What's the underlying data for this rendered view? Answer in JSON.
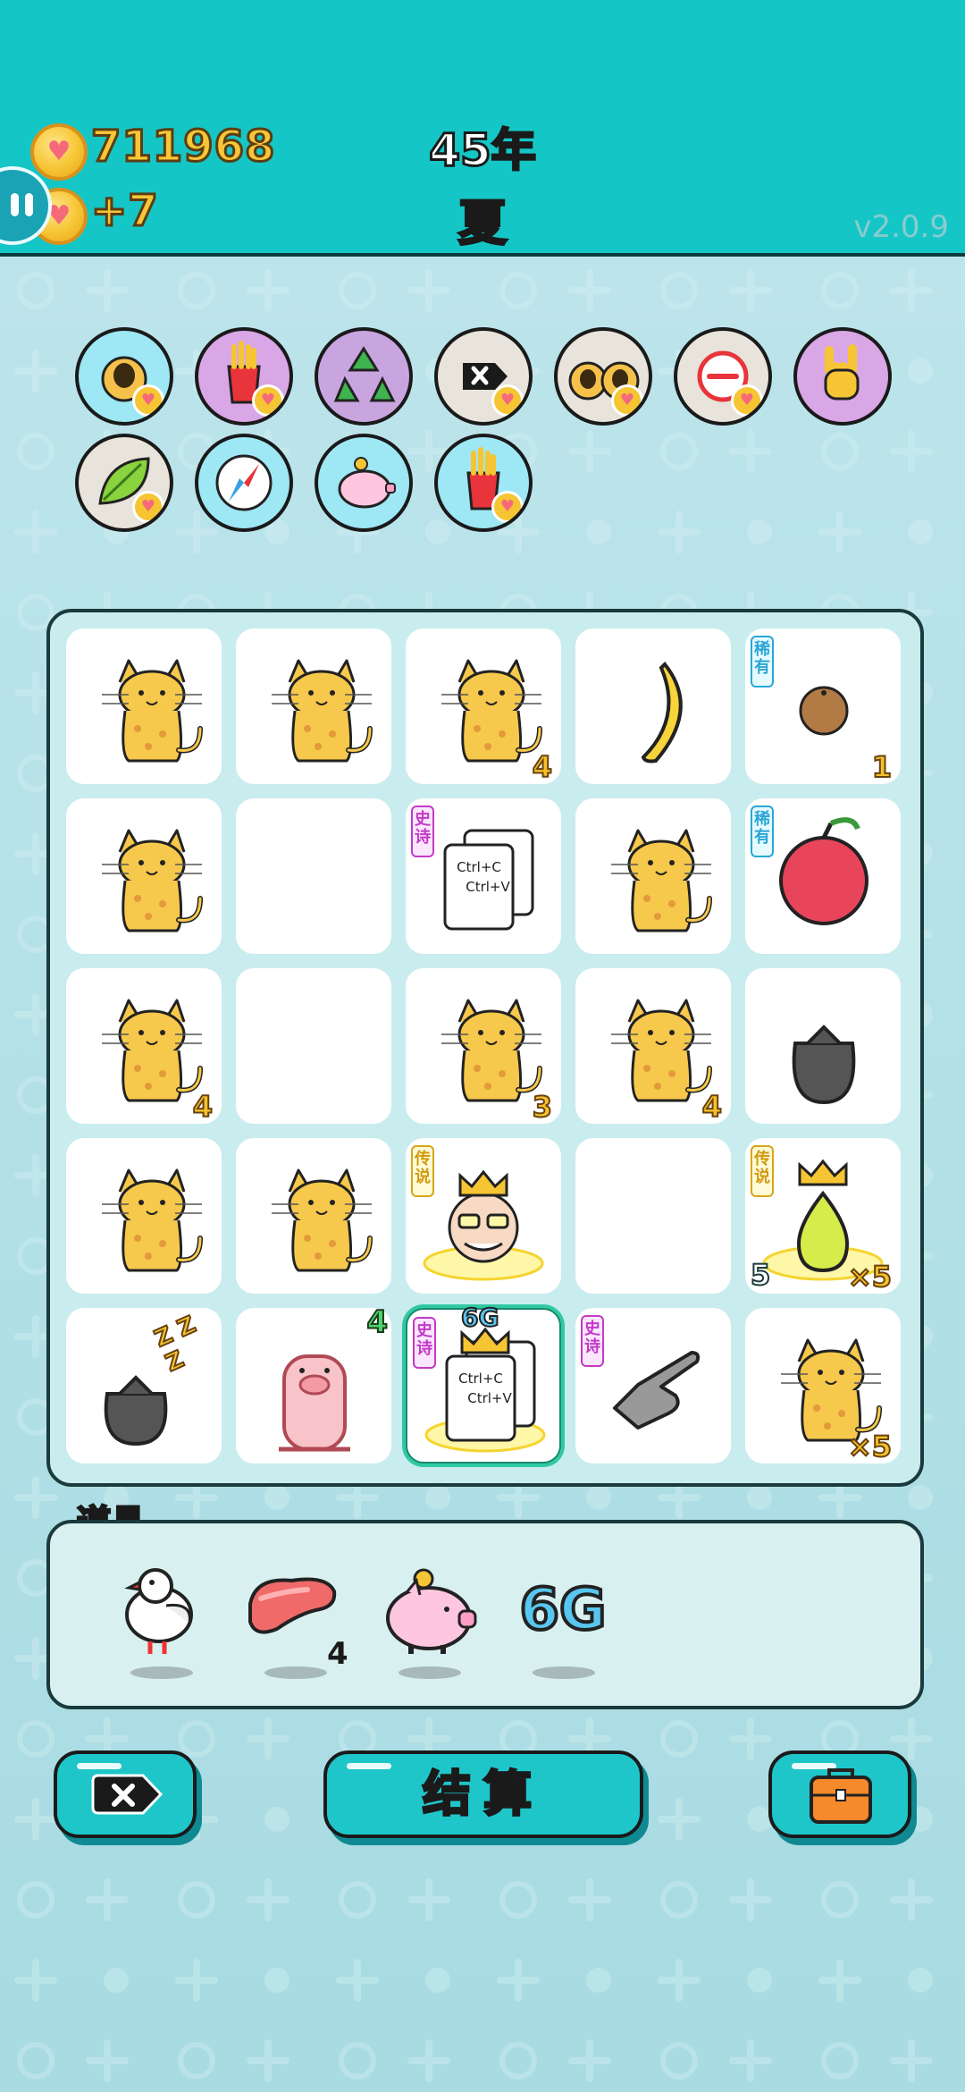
{
  "header": {
    "coins": "711968",
    "income": "+7",
    "year": "45年",
    "season": "夏",
    "version": "v2.0.9"
  },
  "buffs": [
    {
      "icon": "cat-portrait-icon",
      "bg": "#9ee7f4",
      "heart": true
    },
    {
      "icon": "fries-icon",
      "bg": "#d9a6e6",
      "heart": true
    },
    {
      "icon": "recycle-icon",
      "bg": "#c9a5e0",
      "heart": false
    },
    {
      "icon": "delete-tag-icon",
      "bg": "#e8e4dc",
      "heart": true
    },
    {
      "icon": "cat-pair-icon",
      "bg": "#e8e4dc",
      "heart": true
    },
    {
      "icon": "minus-circle-icon",
      "bg": "#e8e4dc",
      "heart": true
    },
    {
      "icon": "rock-hand-icon",
      "bg": "#d9a6e6",
      "heart": false
    },
    {
      "icon": "leaf-icon",
      "bg": "#e8e4dc",
      "heart": true
    },
    {
      "icon": "compass-icon",
      "bg": "#9ee7f4",
      "heart": false
    },
    {
      "icon": "piggy-bank-icon",
      "bg": "#9ee7f4",
      "heart": false
    },
    {
      "icon": "fries-icon",
      "bg": "#9ee7f4",
      "heart": true
    }
  ],
  "board": [
    [
      {
        "item": "cat"
      },
      {
        "item": "cat"
      },
      {
        "item": "cat",
        "qty": "4"
      },
      {
        "item": "banana"
      },
      {
        "item": "coconut",
        "rarity": "稀有",
        "rarity_type": "rare",
        "qty": "1"
      }
    ],
    [
      {
        "item": "cat"
      },
      {
        "item": "empty"
      },
      {
        "item": "ctrlcv",
        "rarity": "史诗",
        "rarity_type": "epic",
        "text1": "Ctrl+C",
        "text2": "Ctrl+V"
      },
      {
        "item": "cat"
      },
      {
        "item": "lychee",
        "rarity": "稀有",
        "rarity_type": "rare"
      }
    ],
    [
      {
        "item": "cat",
        "qty": "4"
      },
      {
        "item": "empty"
      },
      {
        "item": "cat",
        "qty": "3"
      },
      {
        "item": "cat",
        "qty": "4"
      },
      {
        "item": "trash"
      }
    ],
    [
      {
        "item": "cat"
      },
      {
        "item": "cat"
      },
      {
        "item": "king",
        "rarity": "传说",
        "rarity_type": "legend"
      },
      {
        "item": "empty"
      },
      {
        "item": "pear",
        "rarity": "传说",
        "rarity_type": "legend",
        "qty": "×5",
        "qty_left": "5"
      }
    ],
    [
      {
        "item": "trash-sleep",
        "zzz": "Z Z Z"
      },
      {
        "item": "pig",
        "qty_top": "4"
      },
      {
        "item": "ctrlcv-king",
        "rarity": "史诗",
        "rarity_type": "epic",
        "text1": "Ctrl+C",
        "text2": "Ctrl+V",
        "label_top": "6G",
        "selected": true
      },
      {
        "item": "hand",
        "rarity": "史诗",
        "rarity_type": "epic"
      },
      {
        "item": "cat",
        "qty": "×5"
      }
    ]
  ],
  "items_panel": {
    "title": "道具",
    "items": [
      {
        "icon": "white-bird-icon"
      },
      {
        "icon": "liver-icon",
        "count": "4"
      },
      {
        "icon": "piggy-bank-icon"
      },
      {
        "icon": "6g-icon",
        "text": "6G"
      }
    ]
  },
  "buttons": {
    "delete_icon": "delete-tag-icon",
    "settle_label": "结算",
    "bag_icon": "briefcase-icon"
  }
}
